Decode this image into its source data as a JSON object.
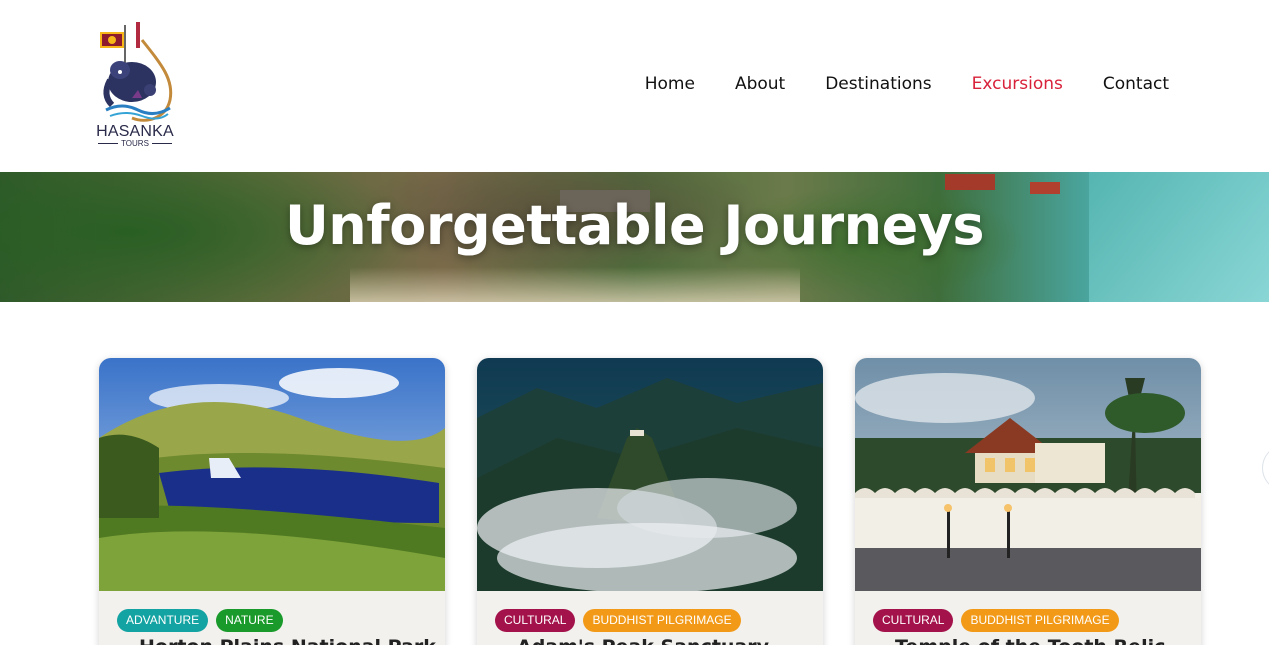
{
  "brand": {
    "name": "HASANKA",
    "tagline": "TOURS"
  },
  "nav": {
    "items": [
      {
        "label": "Home"
      },
      {
        "label": "About"
      },
      {
        "label": "Destinations"
      },
      {
        "label": "Excursions"
      },
      {
        "label": "Contact"
      }
    ],
    "active_index": 3,
    "active_color": "#d8213a"
  },
  "hero": {
    "title": "Unforgettable Journeys"
  },
  "cards": [
    {
      "tags": [
        "ADVANTURE",
        "NATURE"
      ],
      "title": "Horton Plains National Park"
    },
    {
      "tags": [
        "CULTURAL",
        "BUDDHIST PILGRIMAGE"
      ],
      "title": "Adam's Peak Sanctuary"
    },
    {
      "tags": [
        "CULTURAL",
        "BUDDHIST PILGRIMAGE"
      ],
      "title": "Temple of the Tooth Relic"
    }
  ],
  "colors": {
    "tag_adventure": "#14a3a3",
    "tag_nature": "#1a9a2a",
    "tag_cultural": "#a3124a",
    "tag_pilgrimage": "#f29a18"
  }
}
